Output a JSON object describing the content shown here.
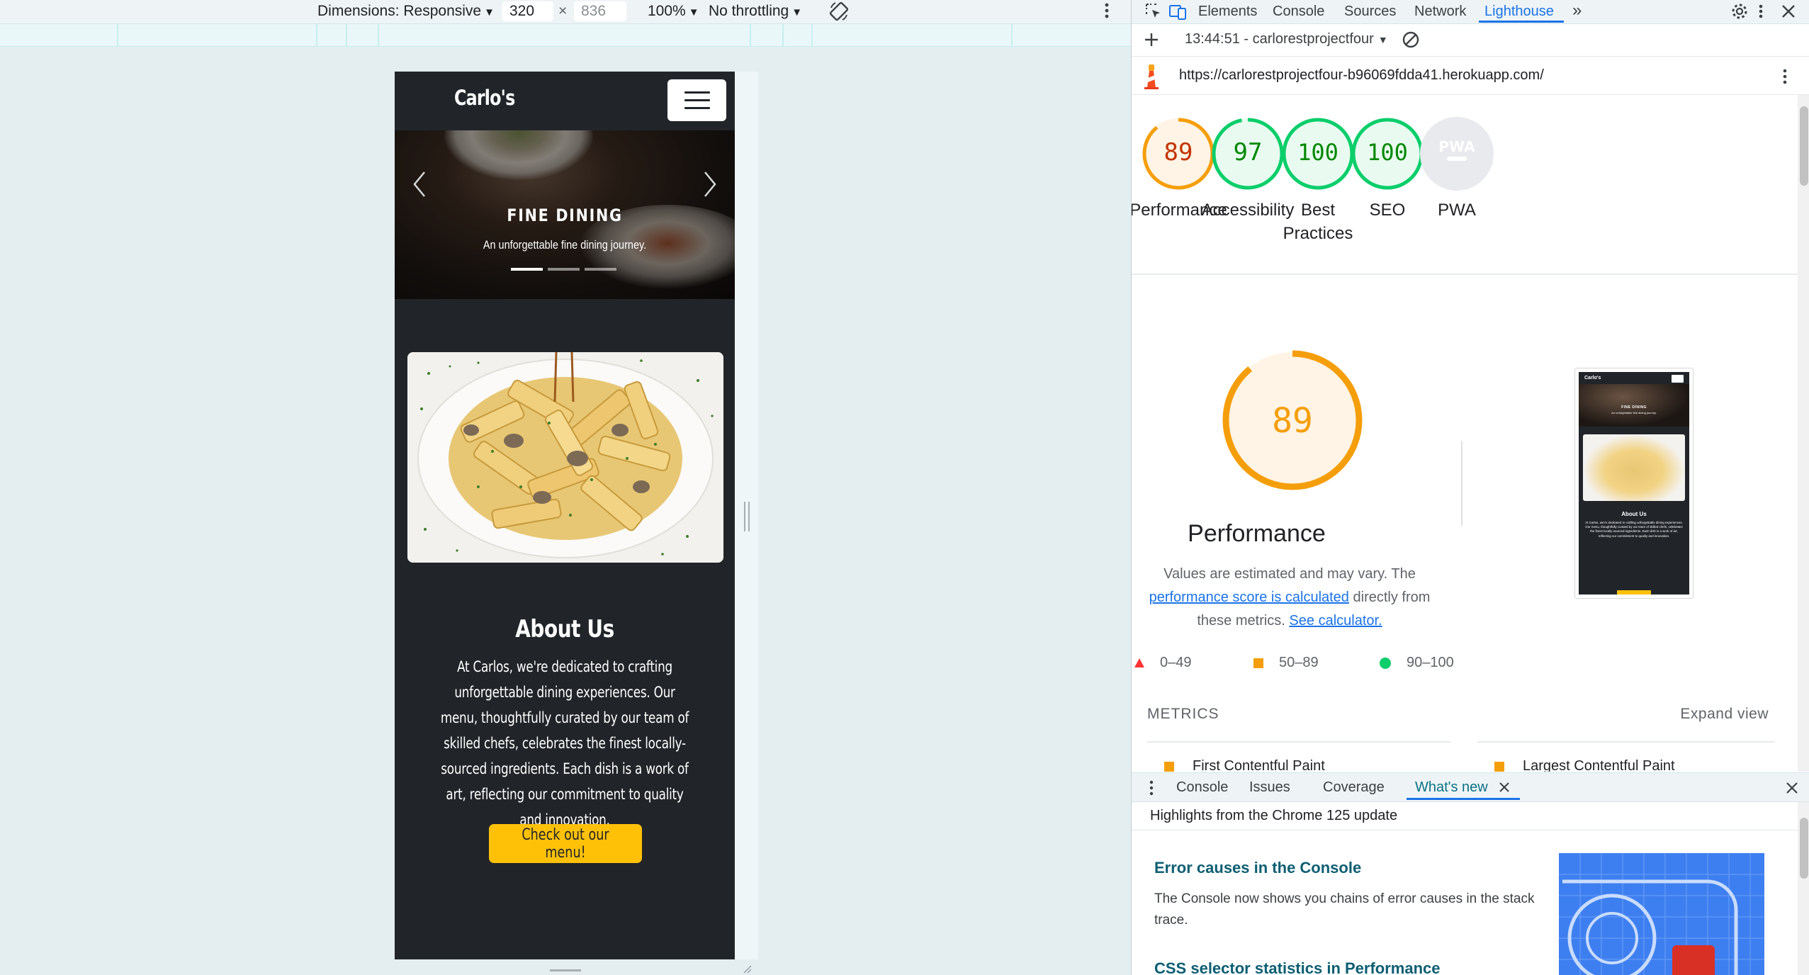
{
  "device_toolbar": {
    "dimensions_label": "Dimensions: Responsive",
    "width_value": "320",
    "times": "×",
    "height_placeholder": "836",
    "zoom": "100%",
    "throttling": "No throttling"
  },
  "site": {
    "brand": "Carlo's",
    "hero": {
      "title": "FINE DINING",
      "subtitle": "An unforgettable fine dining journey.",
      "slide_count": 3,
      "active_slide": 1
    },
    "about": {
      "title": "About Us",
      "text": "At Carlos, we're dedicated to crafting unforgettable dining experiences. Our menu, thoughtfully curated by our team of skilled chefs, celebrates the finest locally-sourced ingredients. Each dish is a work of art, reflecting our commitment to quality and innovation.",
      "button": "Check out our menu!"
    }
  },
  "devtools": {
    "tabs": [
      "Elements",
      "Console",
      "Sources",
      "Network",
      "Lighthouse"
    ],
    "active_tab": "Lighthouse",
    "more_tabs": "»",
    "report_selector": "13:44:51 - carlorestprojectfour",
    "url": "https://carlorestprojectfour-b96069fdda41.herokuapp.com/",
    "scores": [
      {
        "label": "Performance",
        "value": "89",
        "color": "#f59e0b",
        "text_color": "#c33300"
      },
      {
        "label": "Accessibility",
        "value": "97",
        "color": "#0cce6b",
        "text_color": "#008800"
      },
      {
        "label": "Best Practices",
        "value": "100",
        "color": "#0cce6b",
        "text_color": "#008800"
      },
      {
        "label": "SEO",
        "value": "100",
        "color": "#0cce6b",
        "text_color": "#008800"
      },
      {
        "label": "PWA",
        "value": "PWA",
        "color": "#9aa0a6"
      }
    ],
    "performance": {
      "score": "89",
      "title": "Performance",
      "desc_prefix": "Values are estimated and may vary. The",
      "desc_link1": "performance score is calculated",
      "desc_middle": "directly from these metrics.",
      "desc_link2": "See calculator."
    },
    "legend": [
      {
        "range": "0–49",
        "color": "#ff3333"
      },
      {
        "range": "50–89",
        "color": "#f59e0b"
      },
      {
        "range": "90–100",
        "color": "#0cce6b"
      }
    ],
    "metrics_heading": "METRICS",
    "expand_view": "Expand view",
    "metrics": [
      {
        "name": "First Contentful Paint"
      },
      {
        "name": "Largest Contentful Paint"
      }
    ],
    "thumbnail": {
      "brand": "Carlo's",
      "hero_title": "FINE DINING",
      "hero_sub": "An unforgettable fine dining journey.",
      "about_title": "About Us",
      "about_text": "At Carlos, we're dedicated to crafting unforgettable dining experiences. Our menu, thoughtfully curated by our team of skilled chefs, celebrates the finest locally-sourced ingredients. Each dish is a work of art, reflecting our commitment to quality and innovation."
    }
  },
  "drawer": {
    "tabs": [
      "Console",
      "Issues",
      "Coverage",
      "What's new"
    ],
    "active_tab": "What's new",
    "highlights": "Highlights from the Chrome 125 update",
    "card1_title": "Error causes in the Console",
    "card1_text": "The Console now shows you chains of error causes in the stack trace.",
    "card2_title": "CSS selector statistics in Performance"
  }
}
